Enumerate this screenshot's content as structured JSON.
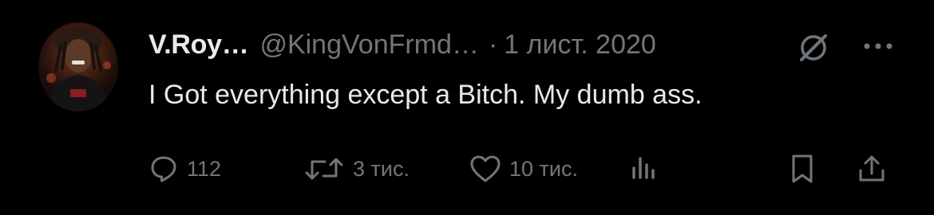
{
  "author": {
    "display_name": "V.Roy…",
    "handle": "@KingVonFrmd…",
    "separator": "·",
    "date": "1 лист. 2020"
  },
  "tweet": {
    "text": "I Got everything except a Bitch. My dumb ass."
  },
  "actions": {
    "replies": "112",
    "retweets": "3 тис.",
    "likes": "10 тис.",
    "views": ""
  },
  "icons": {
    "avatar": "profile-photo",
    "grok": "grok-icon",
    "more": "more-icon",
    "reply": "reply-icon",
    "retweet": "retweet-icon",
    "like": "heart-icon",
    "views": "bar-chart-icon",
    "bookmark": "bookmark-icon",
    "share": "share-icon"
  },
  "colors": {
    "background": "#000000",
    "text_primary": "#e7e9ea",
    "text_secondary": "#71767b"
  }
}
